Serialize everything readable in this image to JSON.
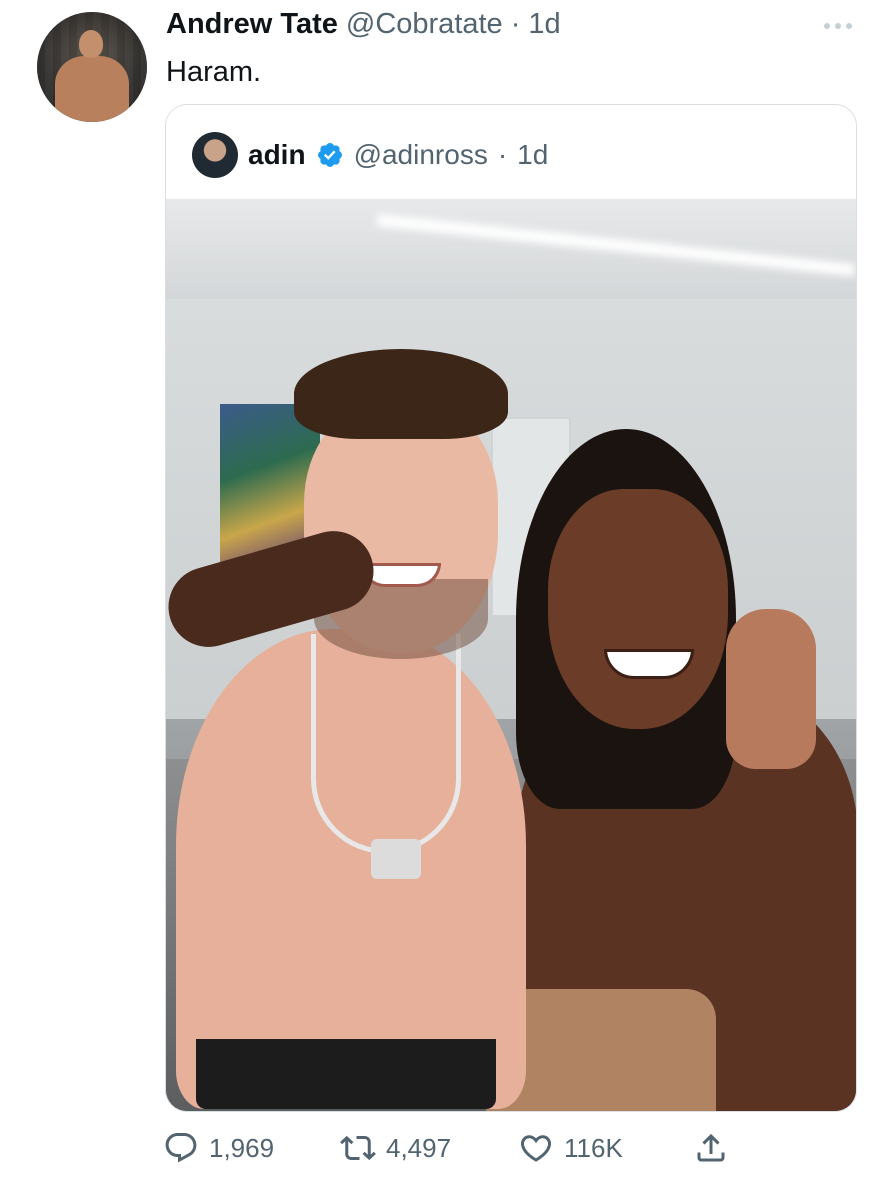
{
  "author": {
    "name": "Andrew Tate",
    "handle": "@Cobratate",
    "separator": "·",
    "time": "1d"
  },
  "text": "Haram.",
  "quoted": {
    "name": "adin",
    "handle": "@adinross",
    "separator": "·",
    "time": "1d",
    "verified": true,
    "image_alt": "Two shirtless men posing, one with arm around the other giving a thumbs up"
  },
  "actions": {
    "replies": "1,969",
    "retweets": "4,497",
    "likes": "116K"
  },
  "icons": {
    "more": "more-icon",
    "reply": "reply-icon",
    "retweet": "retweet-icon",
    "like": "heart-icon",
    "share": "share-icon",
    "verified": "verified-badge-icon"
  },
  "colors": {
    "text": "#0f1419",
    "secondary": "#536471",
    "verified": "#1d9bf0",
    "border": "#d9dfe3"
  }
}
